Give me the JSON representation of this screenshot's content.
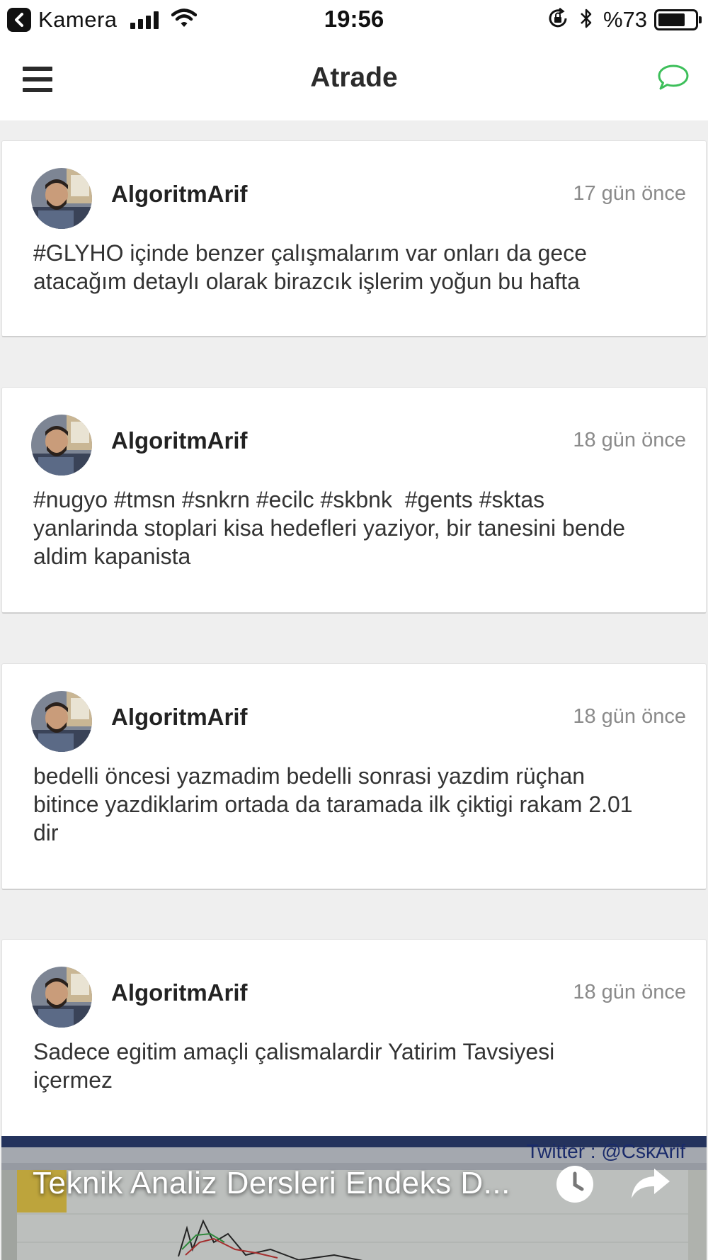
{
  "status_bar": {
    "back_app": "Kamera",
    "time": "19:56",
    "battery": "%73",
    "battery_level": 0.73
  },
  "nav": {
    "title": "Atrade",
    "accent_color": "#3dbf5a"
  },
  "posts": [
    {
      "author": "AlgoritmArif",
      "time": "17 gün önce",
      "body": "#GLYHO içinde benzer çalışmalarım var onları da gece\natacağım detaylı olarak birazcık işlerim yoğun bu hafta"
    },
    {
      "author": "AlgoritmArif",
      "time": "18 gün önce",
      "body": "#nugyo #tmsn #snkrn #ecilc #skbnk  #gents #sktas\nyanlarinda stoplari kisa hedefleri yaziyor, bir tanesini bende\naldim kapanista"
    },
    {
      "author": "AlgoritmArif",
      "time": "18 gün önce",
      "body": "bedelli öncesi yazmadim bedelli sonrasi yazdim rüçhan\nbitince yazdiklarim ortada da taramada ilk çiktigi rakam 2.01\ndir"
    },
    {
      "author": "AlgoritmArif",
      "time": "18 gün önce",
      "body": "Sadece egitim amaçli çalismalardir Yatirim Tavsiyesi\niçermez"
    }
  ],
  "video": {
    "title": "Teknik Analiz Dersleri Endeks D...",
    "overlay_text": "Twitter : @CskArif"
  }
}
